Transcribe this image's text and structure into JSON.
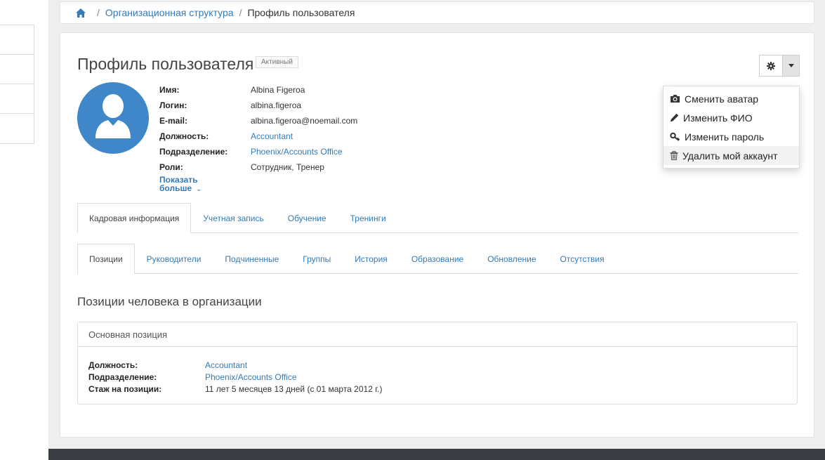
{
  "breadcrumb": {
    "items": [
      {
        "label": "Организационная структура"
      },
      {
        "label": "Профиль пользователя"
      }
    ],
    "separator": "/"
  },
  "profile": {
    "title": "Профиль пользователя",
    "status": "Активный",
    "fields": [
      {
        "label": "Имя:",
        "value": "Albina Figeroa"
      },
      {
        "label": "Логин:",
        "value": "albina.figeroa"
      },
      {
        "label": "E-mail:",
        "value": "albina.figeroa@noemail.com"
      },
      {
        "label": "Должность:",
        "value": "Accountant"
      },
      {
        "label": "Подразделение:",
        "value": "Phoenix/Accounts Office"
      },
      {
        "label": "Роли:",
        "value": "Сотрудник, Тренер"
      }
    ],
    "show_more_line1": "Показать",
    "show_more_line2": "больше",
    "show_more_chevron": "⌄"
  },
  "actions_menu": {
    "items": [
      {
        "label": "Сменить аватар",
        "icon": "camera-icon"
      },
      {
        "label": "Изменить ФИО",
        "icon": "pencil-icon"
      },
      {
        "label": "Изменить пароль",
        "icon": "key-icon"
      },
      {
        "label": "Удалить мой аккаунт",
        "icon": "trash-icon"
      }
    ]
  },
  "tabs_primary": [
    {
      "label": "Кадровая информация",
      "active": true
    },
    {
      "label": "Учетная запись"
    },
    {
      "label": "Обучение"
    },
    {
      "label": "Тренинги"
    }
  ],
  "tabs_secondary": [
    {
      "label": "Позиции",
      "active": true
    },
    {
      "label": "Руководители"
    },
    {
      "label": "Подчиненные"
    },
    {
      "label": "Группы"
    },
    {
      "label": "История"
    },
    {
      "label": "Образование"
    },
    {
      "label": "Обновление"
    },
    {
      "label": "Отсутствия"
    }
  ],
  "positions": {
    "section_title": "Позиции человека в организации",
    "panel_title": "Основная позиция",
    "rows": [
      {
        "label": "Должность:",
        "value": "Accountant"
      },
      {
        "label": "Подразделение:",
        "value": "Phoenix/Accounts Office"
      },
      {
        "label": "Стаж на позиции:",
        "value": "11 лет 5 месяцев 13 дней (с 01 марта 2012 г.)"
      }
    ]
  },
  "colors": {
    "link": "#337ab7",
    "avatar_bg": "#3f87c8",
    "footer": "#3a3d42"
  }
}
